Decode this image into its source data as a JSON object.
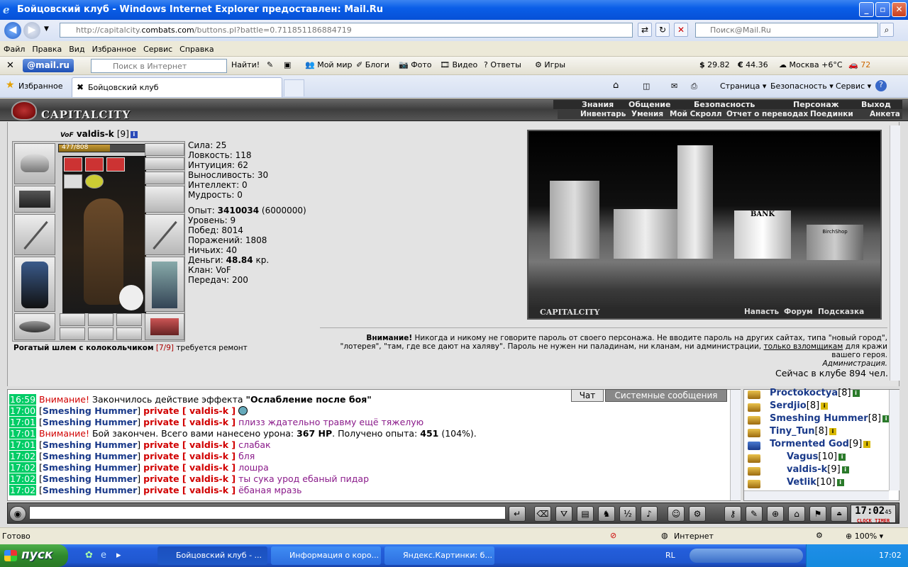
{
  "window": {
    "title": "Бойцовский клуб - Windows Internet Explorer предоставлен: Mail.Ru",
    "min": "_",
    "max": "▫",
    "close": "✕"
  },
  "address": {
    "prefix": "http://capitalcity.",
    "domain": "combats.com",
    "path": "/buttons.pl?battle=0.711851186884719",
    "search_placeholder": "Поиск@Mail.Ru"
  },
  "menu": [
    "Файл",
    "Правка",
    "Вид",
    "Избранное",
    "Сервис",
    "Справка"
  ],
  "mailbar": {
    "logo": "@mail.ru",
    "search_placeholder": "Поиск в Интернет",
    "find": "Найти!",
    "items": [
      "Мой мир",
      "Блоги",
      "Фото",
      "Видео",
      "Ответы",
      "Игры"
    ],
    "usd": "29.82",
    "eur": "44.36",
    "weather": "Москва +6°C",
    "traffic": "72"
  },
  "tabs": {
    "favorites": "Избранное",
    "active": "Бойцовский клуб",
    "tools": [
      "Страница",
      "Безопасность",
      "Сервис"
    ]
  },
  "game": {
    "logo": "CAPITALCITY",
    "menu1": [
      "Знания",
      "Общение",
      "Безопасность",
      "Персонаж",
      "Выход"
    ],
    "menu2": [
      "Инвентарь",
      "Умения",
      "Мой Скролл",
      "Отчет о переводах",
      "Поединки",
      "Анкета"
    ],
    "char": {
      "clan_tag": "VoF",
      "name": "valdis-k",
      "level": "[9]",
      "hp": "477/808",
      "hp_frac": 0.59
    },
    "stats": [
      {
        "label": "Сила:",
        "value": "25"
      },
      {
        "label": "Ловкость:",
        "value": "118"
      },
      {
        "label": "Интуиция:",
        "value": "62"
      },
      {
        "label": "Выносливость:",
        "value": "30"
      },
      {
        "label": "Интеллект:",
        "value": "0"
      },
      {
        "label": "Мудрость:",
        "value": "0"
      }
    ],
    "exp": {
      "label": "Опыт:",
      "value": "3410034",
      "max": "(6000000)"
    },
    "stats2": [
      {
        "label": "Уровень:",
        "value": "9"
      },
      {
        "label": "Побед:",
        "value": "8014"
      },
      {
        "label": "Поражений:",
        "value": "1808"
      },
      {
        "label": "Ничьих:",
        "value": "40"
      }
    ],
    "money": {
      "label": "Деньги:",
      "value": "48.84",
      "unit": "кр."
    },
    "clan": {
      "label": "Клан:",
      "value": "VoF"
    },
    "transfers": {
      "label": "Передач:",
      "value": "200"
    },
    "item": {
      "name": "Рогатый шлем с колокольчиком",
      "durability": "[7/9]",
      "note": "требуется ремонт"
    },
    "city": {
      "name": "CAPITALCITY",
      "bank": "BANK",
      "shop": "BirchShop",
      "links": [
        "Напасть",
        "Форум",
        "Подсказка"
      ]
    },
    "warning": {
      "head": "Внимание!",
      "text1": "Никогда и никому не говорите пароль от своего персонажа. Не вводите пароль на других сайтах, типа \"новый город\",",
      "text2": "\"лотерея\", \"там, где все дают на халяву\". Пароль не нужен ни паладинам, ни кланам, ни администрации,",
      "link": "только взломщикам",
      "text3": "для кражи",
      "text4": "вашего героя.",
      "sign": "Администрация."
    },
    "online": "Сейчас в клубе 894 чел.",
    "chat_tabs": [
      "Чат",
      "Системные сообщения"
    ],
    "chat": [
      {
        "time": "16:59",
        "warn": "Внимание!",
        "text": " Закончилось действие эффекта ",
        "bold": "\"Ослабление после боя\""
      },
      {
        "time": "17:00",
        "name": "Smeshing Hummer",
        "priv": "private [ valdis-k ]",
        "msg": ""
      },
      {
        "time": "17:01",
        "name": "Smeshing Hummer",
        "priv": "private [ valdis-k ]",
        "msg": "плизз ждательно травму ещё тяжелую"
      },
      {
        "time": "17:01",
        "warn": "Внимание!",
        "text": " Бой закончен. Всего вами нанесено урона: ",
        "b1": "367 HP",
        "t2": ". Получено опыта: ",
        "b2": "451",
        "t3": " (104%)."
      },
      {
        "time": "17:01",
        "name": "Smeshing Hummer",
        "priv": "private [ valdis-k ]",
        "msg": "слабак"
      },
      {
        "time": "17:02",
        "name": "Smeshing Hummer",
        "priv": "private [ valdis-k ]",
        "msg": "бля"
      },
      {
        "time": "17:02",
        "name": "Smeshing Hummer",
        "priv": "private [ valdis-k ]",
        "msg": "лошра"
      },
      {
        "time": "17:02",
        "name": "Smeshing Hummer",
        "priv": "private [ valdis-k ]",
        "msg": "ты сука урод ебаный пидар"
      },
      {
        "time": "17:02",
        "name": "Smeshing Hummer",
        "priv": "private [ valdis-k ]",
        "msg": "ёбаная мразь"
      }
    ],
    "users": [
      {
        "name": "Proctokoctya",
        "lv": "[8]"
      },
      {
        "name": "Serdjio",
        "lv": "[8]"
      },
      {
        "name": "Smeshing Hummer",
        "lv": "[8]"
      },
      {
        "name": "Tiny_Tun",
        "lv": "[8]"
      },
      {
        "name": "Tormented God",
        "lv": "[9]"
      },
      {
        "name": "Vagus",
        "lv": "[10]"
      },
      {
        "name": "valdis-k",
        "lv": "[9]"
      },
      {
        "name": "Vetlik",
        "lv": "[10]"
      }
    ],
    "clock": "17:02",
    "clock_sec": "45",
    "clock_labels": [
      "CLOCK",
      "TIMER"
    ]
  },
  "status": {
    "ready": "Готово",
    "zone": "Интернет",
    "zoom": "100%"
  },
  "taskbar": {
    "start": "пуск",
    "tasks": [
      "Бойцовский клуб - ...",
      "Информация о коро...",
      "Яндекс.Картинки: б..."
    ],
    "lang": "RL",
    "time": "17:02"
  }
}
